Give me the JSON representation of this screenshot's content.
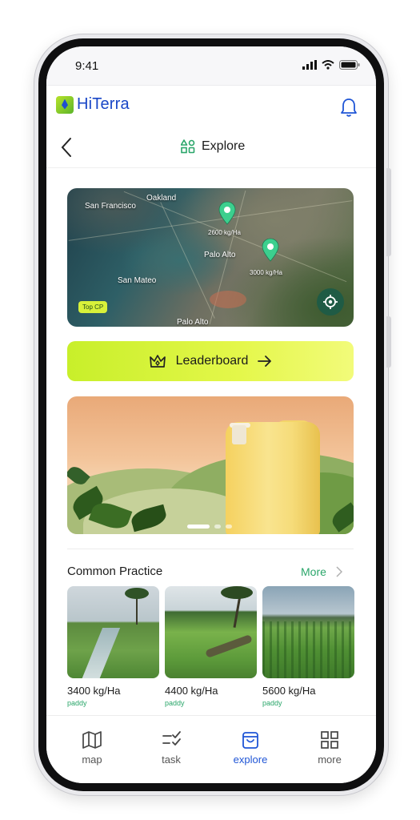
{
  "status": {
    "time": "9:41"
  },
  "header": {
    "brand": "HiTerra"
  },
  "nav": {
    "title": "Explore"
  },
  "map": {
    "places": [
      "San Francisco",
      "Oakland",
      "Palo Alto",
      "San Mateo",
      "Palo Alto"
    ],
    "pins": [
      {
        "yield": "2600 kg/Ha"
      },
      {
        "yield": "3000 kg/Ha"
      }
    ],
    "badge": "Top CP"
  },
  "leaderboard": {
    "label": "Leaderboard"
  },
  "banner": {
    "slides": 3,
    "active_slide": 1
  },
  "common_practice": {
    "title": "Common Practice",
    "more": "More",
    "items": [
      {
        "yield": "3400 kg/Ha",
        "crop": "paddy"
      },
      {
        "yield": "4400 kg/Ha",
        "crop": "paddy"
      },
      {
        "yield": "5600 kg/Ha",
        "crop": "paddy"
      }
    ]
  },
  "tabs": [
    {
      "label": "map",
      "icon": "map-icon"
    },
    {
      "label": "task",
      "icon": "task-icon"
    },
    {
      "label": "explore",
      "icon": "shopping-bag-icon",
      "active": true
    },
    {
      "label": "more",
      "icon": "grid-icon"
    }
  ],
  "colors": {
    "brand_blue": "#1f55d6",
    "accent_green": "#2aa66a",
    "lime": "#c8ef2a",
    "pin_green": "#3ccf8e"
  }
}
